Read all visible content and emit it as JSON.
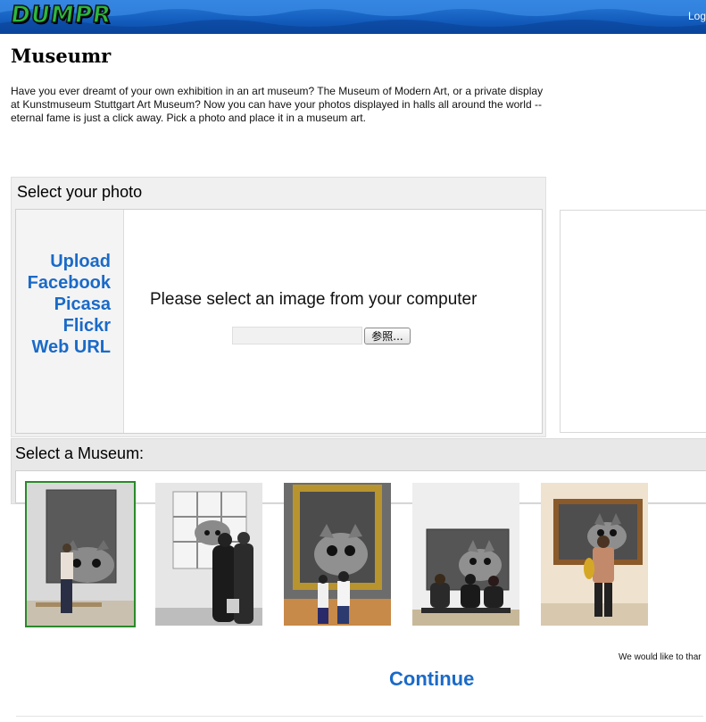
{
  "header": {
    "logo_text": "DUMPR",
    "login_label": "Log",
    "logo_color": "#2db83d",
    "bar_color": "#1560c0"
  },
  "intro": {
    "title": "Museumr",
    "description": "Have you ever dreamt of your own exhibition in an art museum? The Museum of Modern Art, or a private display at Kunstmuseum Stuttgart Art Museum? Now you can have your photos displayed in halls all around the world -- eternal fame is just a click away. Pick a photo and place it in a museum art."
  },
  "photo_panel": {
    "title": "Select your photo",
    "sources": [
      "Upload",
      "Facebook",
      "Picasa",
      "Flickr",
      "Web URL"
    ],
    "upload_prompt": "Please select an image from your computer",
    "file_input_value": "",
    "browse_label": "参照..."
  },
  "museum_panel": {
    "title": "Select a Museum:",
    "selected_index": 0,
    "museums": [
      {
        "name": "museum-1",
        "selected": true
      },
      {
        "name": "museum-2",
        "selected": false
      },
      {
        "name": "museum-3",
        "selected": false
      },
      {
        "name": "museum-4",
        "selected": false
      },
      {
        "name": "museum-5",
        "selected": false
      }
    ]
  },
  "footer": {
    "thanks_text": "We would like to thar",
    "continue_label": "Continue"
  },
  "colors": {
    "link": "#1a6ac8",
    "selected_outline": "#2a8a2a",
    "panel_bg": "#f0f0f0"
  }
}
